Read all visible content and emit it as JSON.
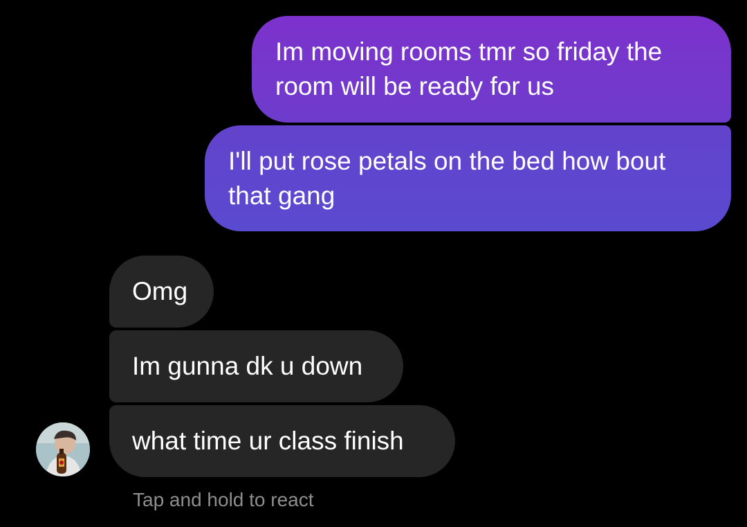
{
  "messages": {
    "sent": [
      {
        "lines": [
          "Im moving rooms tmr so friday the",
          "room will be ready for us"
        ]
      },
      {
        "lines": [
          "I'll put rose petals on the bed how bout",
          "that gang"
        ]
      }
    ],
    "received": [
      {
        "text": "Omg"
      },
      {
        "text": "Im gunna dk u down"
      },
      {
        "text": "what time ur class finish"
      }
    ]
  },
  "avatar": {
    "icon": "user-avatar-photo"
  },
  "hint": "Tap and hold to react",
  "colors": {
    "background": "#000000",
    "sent_bubble_top": "#7c32cc",
    "sent_bubble_bottom": "#5a4ad0",
    "received_bubble": "#262626",
    "hint_text": "#8e8e8e"
  }
}
